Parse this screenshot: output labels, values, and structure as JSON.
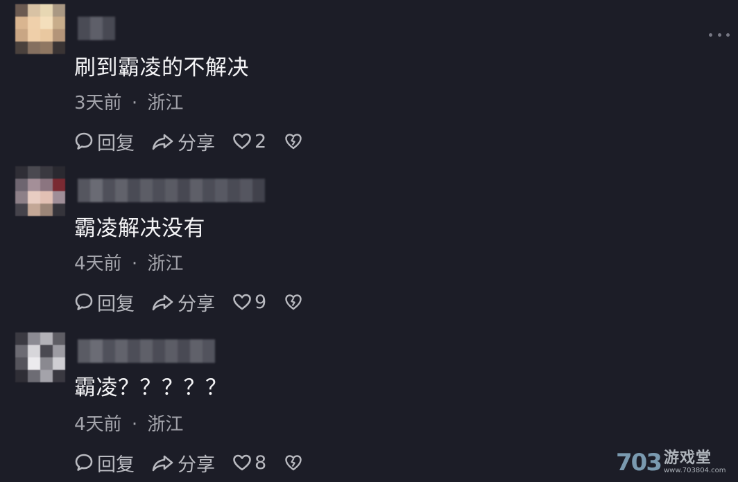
{
  "more_menu": {
    "icon": "more-horizontal-icon"
  },
  "comments": [
    {
      "text": "刷到霸凌的不解决",
      "time": "3天前",
      "separator": "·",
      "location": "浙江",
      "reply_label": "回复",
      "share_label": "分享",
      "like_count": "2"
    },
    {
      "text": "霸凌解决没有",
      "time": "4天前",
      "separator": "·",
      "location": "浙江",
      "reply_label": "回复",
      "share_label": "分享",
      "like_count": "9"
    },
    {
      "text": "霸凌？？？？？",
      "time": "4天前",
      "separator": "·",
      "location": "浙江",
      "reply_label": "回复",
      "share_label": "分享",
      "like_count": "8"
    }
  ],
  "watermark": {
    "logo": "703",
    "name": "游戏堂",
    "url": "www.703804.com"
  },
  "colors": {
    "background": "#1c1d27",
    "text": "#f4f4f6",
    "meta": "#a3a4ab",
    "icon": "#b9bac0"
  }
}
